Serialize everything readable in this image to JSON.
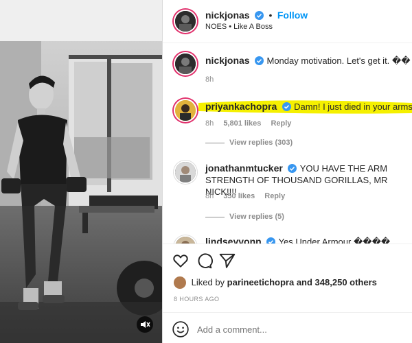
{
  "post": {
    "username": "nickjonas",
    "follow_label": "Follow",
    "dot": "•",
    "subtitle": "NOES • Like A Boss"
  },
  "caption": {
    "username": "nickjonas",
    "text": "Monday motivation. Let's get it. ��",
    "time": "8h"
  },
  "comments": [
    {
      "username": "priyankachopra",
      "text": "Damn! I just died in your arms... � � �",
      "time": "8h",
      "likes": "5,801 likes",
      "reply": "Reply",
      "view_replies": "View replies (303)",
      "highlight_color": "#f5f000"
    },
    {
      "username": "jonathanmtucker",
      "text": "YOU HAVE THE ARM STRENGTH OF THOUSAND GORILLAS, MR NICK!!!!",
      "time": "8h",
      "likes": "350 likes",
      "reply": "Reply",
      "view_replies": "View replies (5)"
    },
    {
      "username": "lindseyvonn",
      "text": "Yes Under Armour ����"
    }
  ],
  "liked_by": {
    "prefix": "Liked by",
    "user": "parineetichopra",
    "rest": "and 348,250 others"
  },
  "timestamp": "8 HOURS AGO",
  "comment_box": {
    "placeholder": "Add a comment..."
  },
  "icons": {
    "like": "heart-icon",
    "comment": "comment-icon",
    "share": "send-icon",
    "emoji": "emoji-icon",
    "mute": "muted-speaker-icon"
  },
  "colors": {
    "verified": "#3897f0",
    "follow": "#0095f6",
    "muted_text": "#8e8e8e"
  }
}
